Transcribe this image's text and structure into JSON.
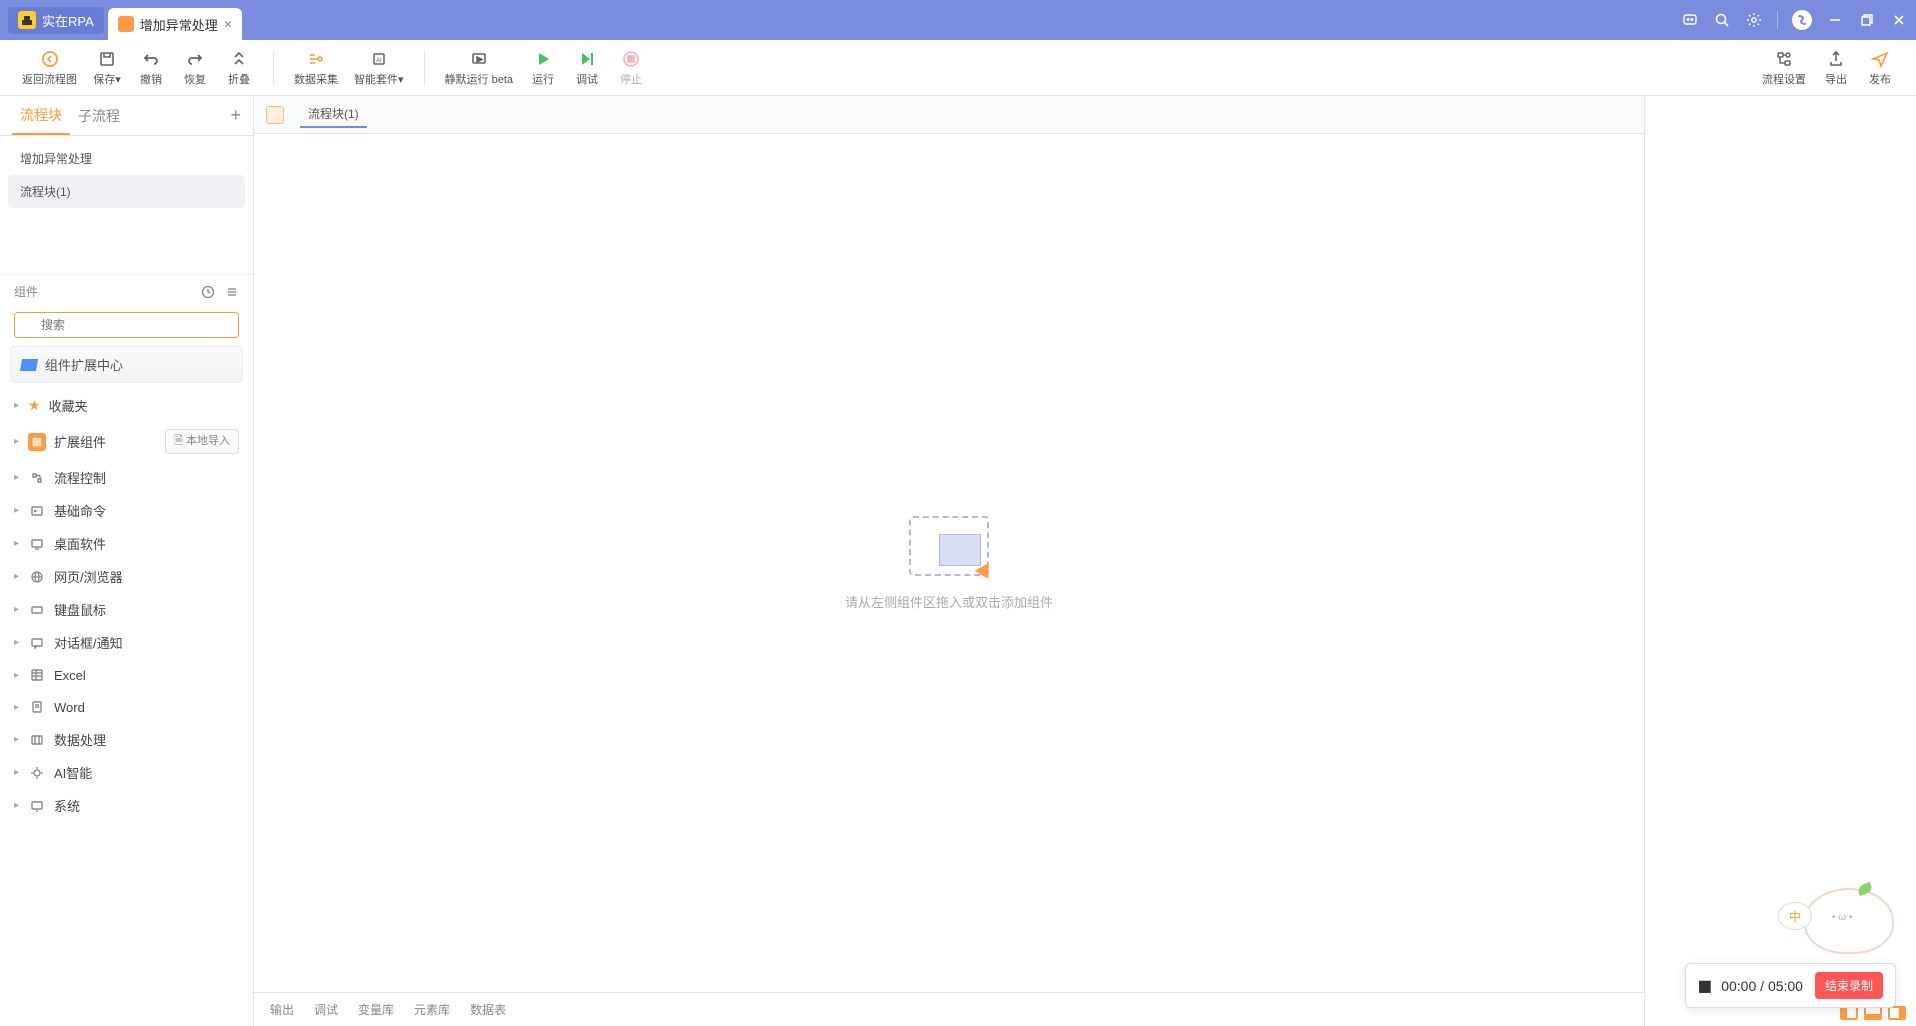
{
  "app": {
    "name": "实在RPA"
  },
  "tabs": [
    {
      "title": "增加异常处理"
    }
  ],
  "toolbar": {
    "back": "返回流程图",
    "save": "保存",
    "undo": "撤销",
    "redo": "恢复",
    "collapse": "折叠",
    "data_collect": "数据采集",
    "ai_kit": "智能套件",
    "silent_run": "静默运行 beta",
    "run": "运行",
    "debug": "调试",
    "stop": "停止",
    "flow_settings": "流程设置",
    "export": "导出",
    "publish": "发布"
  },
  "sidebar": {
    "tabs": {
      "blocks": "流程块",
      "subflows": "子流程"
    },
    "items": [
      {
        "label": "增加异常处理"
      },
      {
        "label": "流程块(1)"
      }
    ],
    "components_label": "组件",
    "search_placeholder": "搜索",
    "extension_center": "组件扩展中心",
    "local_import": "本地导入",
    "tree": [
      {
        "label": "收藏夹",
        "icon": "star"
      },
      {
        "label": "扩展组件",
        "icon": "orange",
        "extra": "local"
      },
      {
        "label": "流程控制",
        "icon": "flow"
      },
      {
        "label": "基础命令",
        "icon": "cmd"
      },
      {
        "label": "桌面软件",
        "icon": "desktop"
      },
      {
        "label": "网页/浏览器",
        "icon": "web"
      },
      {
        "label": "键盘鼠标",
        "icon": "kbm"
      },
      {
        "label": "对话框/通知",
        "icon": "dialog"
      },
      {
        "label": "Excel",
        "icon": "excel"
      },
      {
        "label": "Word",
        "icon": "word"
      },
      {
        "label": "数据处理",
        "icon": "data"
      },
      {
        "label": "AI智能",
        "icon": "ai"
      },
      {
        "label": "系统",
        "icon": "sys"
      }
    ]
  },
  "content": {
    "tab_title": "流程块(1)",
    "empty_hint": "请从左侧组件区拖入或双击添加组件"
  },
  "bottom_tabs": [
    "输出",
    "调试",
    "变量库",
    "元素库",
    "数据表"
  ],
  "recorder": {
    "elapsed": "00:00",
    "total": "05:00",
    "stop_label": "结束录制"
  },
  "mascot": {
    "badge": "中"
  }
}
